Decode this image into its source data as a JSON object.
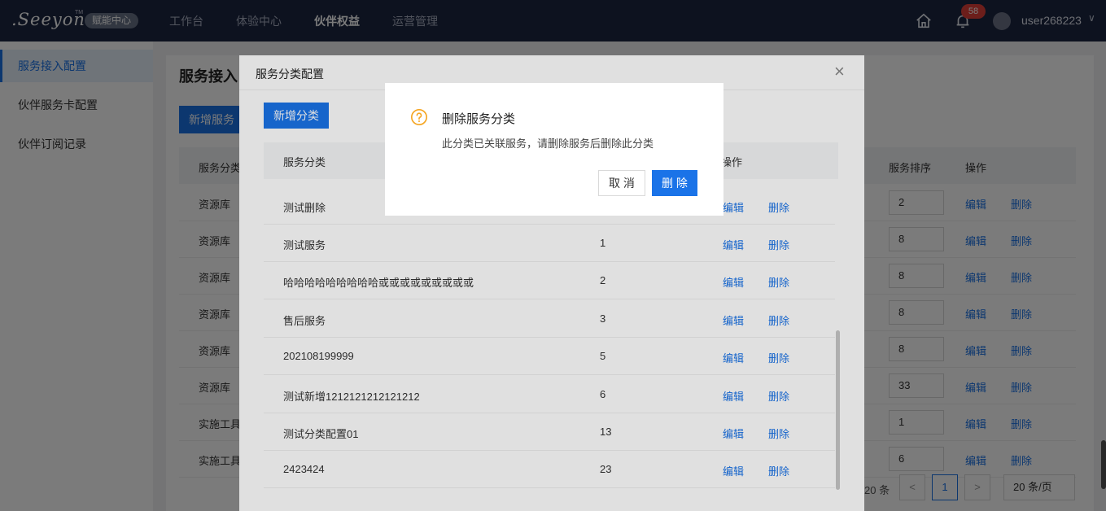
{
  "topbar": {
    "logo_text": ".Seeyon",
    "logo_tm": "TM",
    "badge": "赋能中心",
    "nav": [
      "工作台",
      "体验中心",
      "伙伴权益",
      "运营管理"
    ],
    "notification_count": "58",
    "username": "user268223",
    "chevron": "∨"
  },
  "sidebar": {
    "items": [
      "服务接入配置",
      "伙伴服务卡配置",
      "伙伴订阅记录"
    ]
  },
  "page": {
    "title": "服务接入",
    "add_button": "新增服务",
    "columns": {
      "category": "服务分类",
      "sort": "服务排序",
      "ops": "操作"
    },
    "rows": [
      {
        "category": "资源库",
        "sort": "2"
      },
      {
        "category": "资源库",
        "sort": "8"
      },
      {
        "category": "资源库",
        "sort": "8"
      },
      {
        "category": "资源库",
        "sort": "8"
      },
      {
        "category": "资源库",
        "sort": "8"
      },
      {
        "category": "资源库",
        "sort": "33"
      },
      {
        "category": "实施工具",
        "sort": "1"
      },
      {
        "category": "实施工具",
        "sort": "6"
      }
    ],
    "edit_label": "编辑",
    "delete_label": "删除",
    "pagination": {
      "total": "20 条",
      "prev": "<",
      "current_page": "1",
      "next": ">",
      "page_size": "20 条/页"
    }
  },
  "dialog": {
    "title": "服务分类配置",
    "close": "×",
    "add_button": "新增分类",
    "columns": {
      "category": "服务分类",
      "ops": "操作"
    },
    "rows": [
      {
        "name": "测试删除",
        "sort": ""
      },
      {
        "name": "测试服务",
        "sort": "1"
      },
      {
        "name": "哈哈哈哈哈哈哈哈哈或或或或或或或或或",
        "sort": "2"
      },
      {
        "name": "售后服务",
        "sort": "3"
      },
      {
        "name": "202108199999",
        "sort": "5"
      },
      {
        "name": "测试新增1212121212121212",
        "sort": "6"
      },
      {
        "name": "测试分类配置01",
        "sort": "13"
      },
      {
        "name": "2423424",
        "sort": "23"
      }
    ],
    "edit_label": "编辑",
    "delete_label": "删除"
  },
  "confirm": {
    "title": "删除服务分类",
    "message": "此分类已关联服务，请删除服务后删除此分类",
    "cancel": "取 消",
    "ok": "删 除",
    "icon": "question-circle-icon",
    "icon_color": "#f5a623"
  },
  "colors": {
    "primary": "#1a73e8",
    "topbar": "#1d2742",
    "badge": "#e0413a"
  }
}
